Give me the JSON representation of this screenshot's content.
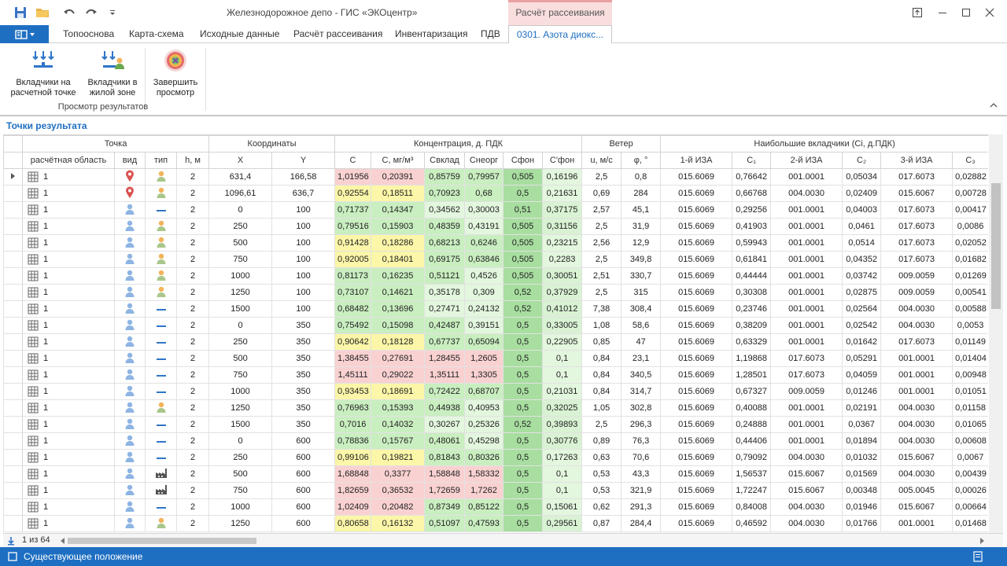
{
  "window": {
    "title": "Железнодорожное депо - ГИС «ЭКОцентр»",
    "context_tab_group": "Расчёт рассеивания"
  },
  "icons": {
    "save": "save-icon",
    "open": "folder-open-icon",
    "undo": "undo-icon",
    "redo": "redo-icon",
    "customize": "chevron-down-icon",
    "restore": "restore-window-icon",
    "minimize": "minimize-icon",
    "maximize": "maximize-icon",
    "close": "close-icon"
  },
  "tabs": [
    {
      "label": "Топооснова"
    },
    {
      "label": "Карта-схема"
    },
    {
      "label": "Исходные данные"
    },
    {
      "label": "Расчёт рассеивания"
    },
    {
      "label": "Инвентаризация"
    },
    {
      "label": "ПДВ"
    },
    {
      "label": "0301. Азота диокс..."
    }
  ],
  "ribbon": {
    "buttons": [
      {
        "label": "Вкладчики на\nрасчетной точке"
      },
      {
        "label": "Вкладчики в\nжилой зоне"
      },
      {
        "label": "Завершить\nпросмотр"
      }
    ],
    "group_label": "Просмотр результатов"
  },
  "panel": {
    "title": "Точки результата"
  },
  "grid": {
    "group_headers": {
      "point": "Точка",
      "coords": "Координаты",
      "conc": "Концентрация, д. ПДК",
      "wind": "Ветер",
      "contrib": "Наибольшие вкладчики (Ci, д.ПДК)"
    },
    "columns": [
      "расчётная область",
      "вид",
      "тип",
      "h, м",
      "X",
      "Y",
      "C",
      "C, мг/м³",
      "Свклад",
      "Снеорг",
      "Сфон",
      "C'фон",
      "u, м/с",
      "φ, °",
      "1-й ИЗА",
      "C₁",
      "2-й ИЗА",
      "C₂",
      "3-й ИЗА",
      "C₃"
    ],
    "rows": [
      {
        "area": "1",
        "vid": "pin-red",
        "tip": "person",
        "h": "2",
        "x": "631,4",
        "y": "166,58",
        "c": "1,01956",
        "cmg": "0,20391",
        "sv": "0,85759",
        "sn": "0,79957",
        "sf": "0,505",
        "cf": "0,16196",
        "u": "2,5",
        "phi": "0,8",
        "iza1": "015.6069",
        "c1": "0,76642",
        "iza2": "001.0001",
        "c2": "0,05034",
        "iza3": "017.6073",
        "c3": "0,02882",
        "col": [
          "cr",
          "cr",
          "cg",
          "cg",
          "cd",
          "cl"
        ]
      },
      {
        "area": "1",
        "vid": "pin-red",
        "tip": "person",
        "h": "2",
        "x": "1096,61",
        "y": "636,7",
        "c": "0,92554",
        "cmg": "0,18511",
        "sv": "0,70923",
        "sn": "0,68",
        "sf": "0,5",
        "cf": "0,21631",
        "u": "0,69",
        "phi": "284",
        "iza1": "015.6069",
        "c1": "0,66768",
        "iza2": "004.0030",
        "c2": "0,02409",
        "iza3": "015.6067",
        "c3": "0,00728",
        "col": [
          "cy",
          "cy",
          "cg",
          "cg",
          "cd",
          "cl"
        ]
      },
      {
        "area": "1",
        "vid": "pin-blue",
        "tip": "dash",
        "h": "2",
        "x": "0",
        "y": "100",
        "c": "0,71737",
        "cmg": "0,14347",
        "sv": "0,34562",
        "sn": "0,30003",
        "sf": "0,51",
        "cf": "0,37175",
        "u": "2,57",
        "phi": "45,1",
        "iza1": "015.6069",
        "c1": "0,29256",
        "iza2": "001.0001",
        "c2": "0,04003",
        "iza3": "017.6073",
        "c3": "0,00417",
        "col": [
          "cg",
          "cg",
          "cl",
          "cl",
          "cd",
          "ct"
        ]
      },
      {
        "area": "1",
        "vid": "pin-blue",
        "tip": "person",
        "h": "2",
        "x": "250",
        "y": "100",
        "c": "0,79516",
        "cmg": "0,15903",
        "sv": "0,48359",
        "sn": "0,43191",
        "sf": "0,505",
        "cf": "0,31156",
        "u": "2,5",
        "phi": "31,9",
        "iza1": "015.6069",
        "c1": "0,41903",
        "iza2": "001.0001",
        "c2": "0,0461",
        "iza3": "017.6073",
        "c3": "0,0086",
        "col": [
          "cg",
          "cg",
          "cg",
          "cl",
          "cd",
          "ct"
        ]
      },
      {
        "area": "1",
        "vid": "pin-blue",
        "tip": "person",
        "h": "2",
        "x": "500",
        "y": "100",
        "c": "0,91428",
        "cmg": "0,18286",
        "sv": "0,68213",
        "sn": "0,6246",
        "sf": "0,505",
        "cf": "0,23215",
        "u": "2,56",
        "phi": "12,9",
        "iza1": "015.6069",
        "c1": "0,59943",
        "iza2": "001.0001",
        "c2": "0,0514",
        "iza3": "017.6073",
        "c3": "0,02052",
        "col": [
          "cy",
          "cy",
          "cg",
          "cg",
          "cd",
          "cl"
        ]
      },
      {
        "area": "1",
        "vid": "pin-blue",
        "tip": "person",
        "h": "2",
        "x": "750",
        "y": "100",
        "c": "0,92005",
        "cmg": "0,18401",
        "sv": "0,69175",
        "sn": "0,63846",
        "sf": "0,505",
        "cf": "0,2283",
        "u": "2,5",
        "phi": "349,8",
        "iza1": "015.6069",
        "c1": "0,61841",
        "iza2": "001.0001",
        "c2": "0,04352",
        "iza3": "017.6073",
        "c3": "0,01682",
        "col": [
          "cy",
          "cy",
          "cg",
          "cg",
          "cd",
          "cl"
        ]
      },
      {
        "area": "1",
        "vid": "pin-blue",
        "tip": "person",
        "h": "2",
        "x": "1000",
        "y": "100",
        "c": "0,81173",
        "cmg": "0,16235",
        "sv": "0,51121",
        "sn": "0,4526",
        "sf": "0,505",
        "cf": "0,30051",
        "u": "2,51",
        "phi": "330,7",
        "iza1": "015.6069",
        "c1": "0,44444",
        "iza2": "001.0001",
        "c2": "0,03742",
        "iza3": "009.0059",
        "c3": "0,01269",
        "col": [
          "cg",
          "cg",
          "cg",
          "cl",
          "cd",
          "ct"
        ]
      },
      {
        "area": "1",
        "vid": "pin-blue",
        "tip": "person",
        "h": "2",
        "x": "1250",
        "y": "100",
        "c": "0,73107",
        "cmg": "0,14621",
        "sv": "0,35178",
        "sn": "0,309",
        "sf": "0,52",
        "cf": "0,37929",
        "u": "2,5",
        "phi": "315",
        "iza1": "015.6069",
        "c1": "0,30308",
        "iza2": "001.0001",
        "c2": "0,02875",
        "iza3": "009.0059",
        "c3": "0,00541",
        "col": [
          "cg",
          "cg",
          "cl",
          "cl",
          "cd",
          "ct"
        ]
      },
      {
        "area": "1",
        "vid": "pin-blue",
        "tip": "dash",
        "h": "2",
        "x": "1500",
        "y": "100",
        "c": "0,68482",
        "cmg": "0,13696",
        "sv": "0,27471",
        "sn": "0,24132",
        "sf": "0,52",
        "cf": "0,41012",
        "u": "7,38",
        "phi": "308,4",
        "iza1": "015.6069",
        "c1": "0,23746",
        "iza2": "001.0001",
        "c2": "0,02564",
        "iza3": "004.0030",
        "c3": "0,00588",
        "col": [
          "cg",
          "cg",
          "cl",
          "cl",
          "cd",
          "ct"
        ]
      },
      {
        "area": "1",
        "vid": "pin-blue",
        "tip": "dash",
        "h": "2",
        "x": "0",
        "y": "350",
        "c": "0,75492",
        "cmg": "0,15098",
        "sv": "0,42487",
        "sn": "0,39151",
        "sf": "0,5",
        "cf": "0,33005",
        "u": "1,08",
        "phi": "58,6",
        "iza1": "015.6069",
        "c1": "0,38209",
        "iza2": "001.0001",
        "c2": "0,02542",
        "iza3": "004.0030",
        "c3": "0,0053",
        "col": [
          "cg",
          "cg",
          "cg",
          "cl",
          "cd",
          "ct"
        ]
      },
      {
        "area": "1",
        "vid": "pin-blue",
        "tip": "dash",
        "h": "2",
        "x": "250",
        "y": "350",
        "c": "0,90642",
        "cmg": "0,18128",
        "sv": "0,67737",
        "sn": "0,65094",
        "sf": "0,5",
        "cf": "0,22905",
        "u": "0,85",
        "phi": "47",
        "iza1": "015.6069",
        "c1": "0,63329",
        "iza2": "001.0001",
        "c2": "0,01642",
        "iza3": "017.6073",
        "c3": "0,01149",
        "col": [
          "cy",
          "cy",
          "cg",
          "cg",
          "cd",
          "cl"
        ]
      },
      {
        "area": "1",
        "vid": "pin-blue",
        "tip": "dash",
        "h": "2",
        "x": "500",
        "y": "350",
        "c": "1,38455",
        "cmg": "0,27691",
        "sv": "1,28455",
        "sn": "1,2605",
        "sf": "0,5",
        "cf": "0,1",
        "u": "0,84",
        "phi": "23,1",
        "iza1": "015.6069",
        "c1": "1,19868",
        "iza2": "017.6073",
        "c2": "0,05291",
        "iza3": "001.0001",
        "c3": "0,01404",
        "col": [
          "cr",
          "cr",
          "cr",
          "cr",
          "cd",
          "cl"
        ]
      },
      {
        "area": "1",
        "vid": "pin-blue",
        "tip": "dash",
        "h": "2",
        "x": "750",
        "y": "350",
        "c": "1,45111",
        "cmg": "0,29022",
        "sv": "1,35111",
        "sn": "1,3305",
        "sf": "0,5",
        "cf": "0,1",
        "u": "0,84",
        "phi": "340,5",
        "iza1": "015.6069",
        "c1": "1,28501",
        "iza2": "017.6073",
        "c2": "0,04059",
        "iza3": "001.0001",
        "c3": "0,00948",
        "col": [
          "cr",
          "cr",
          "cr",
          "cr",
          "cd",
          "cl"
        ]
      },
      {
        "area": "1",
        "vid": "pin-blue",
        "tip": "dash",
        "h": "2",
        "x": "1000",
        "y": "350",
        "c": "0,93453",
        "cmg": "0,18691",
        "sv": "0,72422",
        "sn": "0,68707",
        "sf": "0,5",
        "cf": "0,21031",
        "u": "0,84",
        "phi": "314,7",
        "iza1": "015.6069",
        "c1": "0,67327",
        "iza2": "009.0059",
        "c2": "0,01246",
        "iza3": "001.0001",
        "c3": "0,01051",
        "col": [
          "cy",
          "cy",
          "cg",
          "cg",
          "cd",
          "cl"
        ]
      },
      {
        "area": "1",
        "vid": "pin-blue",
        "tip": "person",
        "h": "2",
        "x": "1250",
        "y": "350",
        "c": "0,76963",
        "cmg": "0,15393",
        "sv": "0,44938",
        "sn": "0,40953",
        "sf": "0,5",
        "cf": "0,32025",
        "u": "1,05",
        "phi": "302,8",
        "iza1": "015.6069",
        "c1": "0,40088",
        "iza2": "001.0001",
        "c2": "0,02191",
        "iza3": "004.0030",
        "c3": "0,01158",
        "col": [
          "cg",
          "cg",
          "cg",
          "cl",
          "cd",
          "ct"
        ]
      },
      {
        "area": "1",
        "vid": "pin-blue",
        "tip": "dash",
        "h": "2",
        "x": "1500",
        "y": "350",
        "c": "0,7016",
        "cmg": "0,14032",
        "sv": "0,30267",
        "sn": "0,25326",
        "sf": "0,52",
        "cf": "0,39893",
        "u": "2,5",
        "phi": "296,3",
        "iza1": "015.6069",
        "c1": "0,24888",
        "iza2": "001.0001",
        "c2": "0,0367",
        "iza3": "004.0030",
        "c3": "0,01065",
        "col": [
          "cg",
          "cg",
          "cl",
          "cl",
          "cd",
          "ct"
        ]
      },
      {
        "area": "1",
        "vid": "pin-blue",
        "tip": "dash",
        "h": "2",
        "x": "0",
        "y": "600",
        "c": "0,78836",
        "cmg": "0,15767",
        "sv": "0,48061",
        "sn": "0,45298",
        "sf": "0,5",
        "cf": "0,30776",
        "u": "0,89",
        "phi": "76,3",
        "iza1": "015.6069",
        "c1": "0,44406",
        "iza2": "001.0001",
        "c2": "0,01894",
        "iza3": "004.0030",
        "c3": "0,00608",
        "col": [
          "cg",
          "cg",
          "cg",
          "cl",
          "cd",
          "ct"
        ]
      },
      {
        "area": "1",
        "vid": "pin-blue",
        "tip": "dash",
        "h": "2",
        "x": "250",
        "y": "600",
        "c": "0,99106",
        "cmg": "0,19821",
        "sv": "0,81843",
        "sn": "0,80326",
        "sf": "0,5",
        "cf": "0,17263",
        "u": "0,63",
        "phi": "70,6",
        "iza1": "015.6069",
        "c1": "0,79092",
        "iza2": "004.0030",
        "c2": "0,01032",
        "iza3": "015.6067",
        "c3": "0,0067",
        "col": [
          "cy",
          "cy",
          "cg",
          "cg",
          "cd",
          "cl"
        ]
      },
      {
        "area": "1",
        "vid": "pin-blue",
        "tip": "factory",
        "h": "2",
        "x": "500",
        "y": "600",
        "c": "1,68848",
        "cmg": "0,3377",
        "sv": "1,58848",
        "sn": "1,58332",
        "sf": "0,5",
        "cf": "0,1",
        "u": "0,53",
        "phi": "43,3",
        "iza1": "015.6069",
        "c1": "1,56537",
        "iza2": "015.6067",
        "c2": "0,01569",
        "iza3": "004.0030",
        "c3": "0,00439",
        "col": [
          "cr",
          "cr",
          "cr",
          "cr",
          "cd",
          "cl"
        ]
      },
      {
        "area": "1",
        "vid": "pin-blue",
        "tip": "factory",
        "h": "2",
        "x": "750",
        "y": "600",
        "c": "1,82659",
        "cmg": "0,36532",
        "sv": "1,72659",
        "sn": "1,7262",
        "sf": "0,5",
        "cf": "0,1",
        "u": "0,53",
        "phi": "321,9",
        "iza1": "015.6069",
        "c1": "1,72247",
        "iza2": "015.6067",
        "c2": "0,00348",
        "iza3": "005.0045",
        "c3": "0,00026",
        "col": [
          "cr",
          "cr",
          "cr",
          "cr",
          "cd",
          "cl"
        ]
      },
      {
        "area": "1",
        "vid": "pin-blue",
        "tip": "dash",
        "h": "2",
        "x": "1000",
        "y": "600",
        "c": "1,02409",
        "cmg": "0,20482",
        "sv": "0,87349",
        "sn": "0,85122",
        "sf": "0,5",
        "cf": "0,15061",
        "u": "0,62",
        "phi": "291,3",
        "iza1": "015.6069",
        "c1": "0,84008",
        "iza2": "004.0030",
        "c2": "0,01946",
        "iza3": "015.6067",
        "c3": "0,00664",
        "col": [
          "cr",
          "cr",
          "cg",
          "cg",
          "cd",
          "cl"
        ]
      },
      {
        "area": "1",
        "vid": "pin-blue",
        "tip": "person",
        "h": "2",
        "x": "1250",
        "y": "600",
        "c": "0,80658",
        "cmg": "0,16132",
        "sv": "0,51097",
        "sn": "0,47593",
        "sf": "0,5",
        "cf": "0,29561",
        "u": "0,87",
        "phi": "284,4",
        "iza1": "015.6069",
        "c1": "0,46592",
        "iza2": "004.0030",
        "c2": "0,01766",
        "iza3": "001.0001",
        "c3": "0,01468",
        "col": [
          "cy",
          "cy",
          "cg",
          "cg",
          "cd",
          "ct"
        ]
      }
    ]
  },
  "pager": {
    "info": "1 из 64"
  },
  "status": {
    "text": "Существующее положение"
  },
  "colors": {
    "accent": "#1e6fc2",
    "high": "#f9d1d1",
    "mid": "#fbf6a8",
    "low": "#c9eec0",
    "background": "#a8dea0"
  }
}
